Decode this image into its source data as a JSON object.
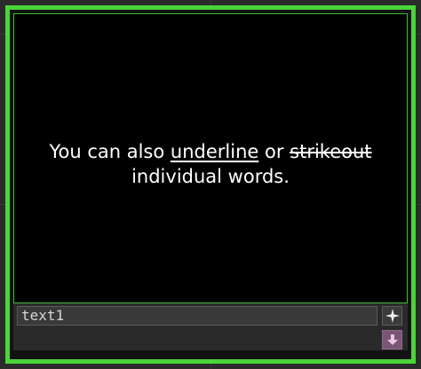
{
  "viewer": {
    "line1_before": "You can also ",
    "line1_underline": "underline",
    "line1_middle": " or ",
    "line1_strike": "strikeout",
    "line2": "individual words."
  },
  "node": {
    "name": "text1",
    "plus_icon": "sparkle-icon",
    "bypass_icon": "arrow-down-icon"
  },
  "colors": {
    "border": "#4ad43a",
    "viewer_bg": "#000000",
    "text": "#ffffff",
    "bypass_bg": "#7a5575"
  }
}
